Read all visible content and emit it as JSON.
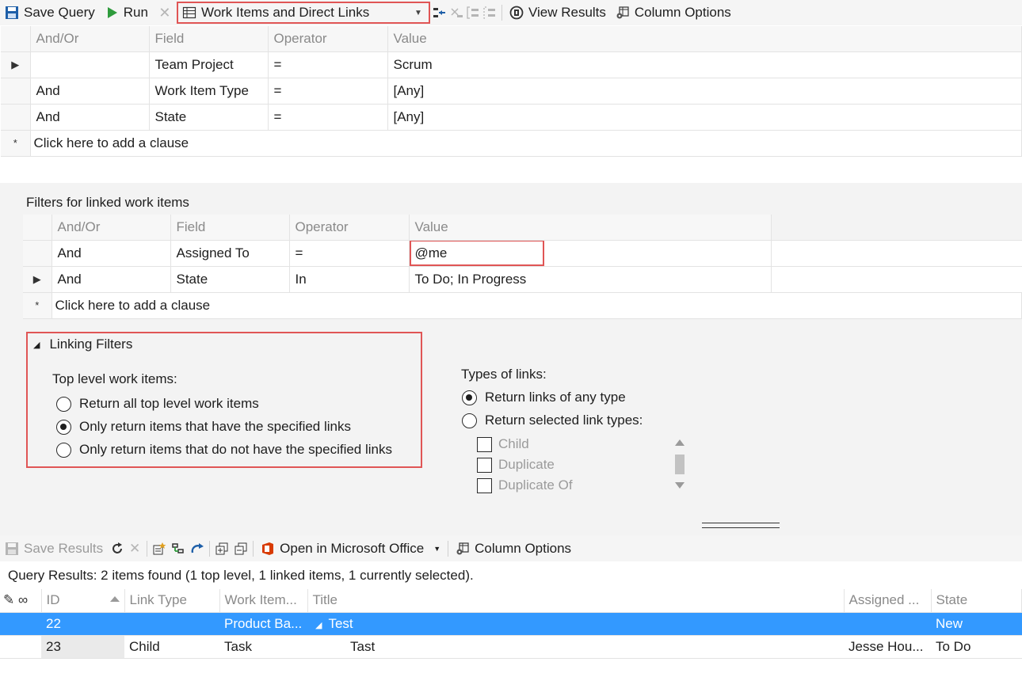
{
  "toolbar": {
    "save_query": "Save Query",
    "run": "Run",
    "query_type": "Work Items and Direct Links",
    "view_results": "View Results",
    "column_options": "Column Options"
  },
  "main_clauses": {
    "headers": [
      "And/Or",
      "Field",
      "Operator",
      "Value"
    ],
    "rows": [
      {
        "andor": "",
        "field": "Team Project",
        "operator": "=",
        "value": "Scrum"
      },
      {
        "andor": "And",
        "field": "Work Item Type",
        "operator": "=",
        "value": "[Any]"
      },
      {
        "andor": "And",
        "field": "State",
        "operator": "=",
        "value": "[Any]"
      }
    ],
    "add_clause": "Click here to add a clause"
  },
  "linked_filters": {
    "title": "Filters for linked work items",
    "headers": [
      "And/Or",
      "Field",
      "Operator",
      "Value"
    ],
    "rows": [
      {
        "andor": "And",
        "field": "Assigned To",
        "operator": "=",
        "value": "@me"
      },
      {
        "andor": "And",
        "field": "State",
        "operator": "In",
        "value": "To Do; In Progress"
      }
    ],
    "add_clause": "Click here to add a clause"
  },
  "linking_filters": {
    "title": "Linking Filters",
    "top_level_label": "Top level work items:",
    "options": [
      {
        "label": "Return all top level work items",
        "selected": false
      },
      {
        "label": "Only return items that have the specified links",
        "selected": true
      },
      {
        "label": "Only return items that do not have the specified links",
        "selected": false
      }
    ],
    "types_label": "Types of links:",
    "type_options": [
      {
        "label": "Return links of any type",
        "selected": true
      },
      {
        "label": "Return selected link types:",
        "selected": false
      }
    ],
    "link_types": [
      "Child",
      "Duplicate",
      "Duplicate Of"
    ]
  },
  "results_toolbar": {
    "save_results": "Save Results",
    "open_office": "Open in Microsoft Office",
    "column_options": "Column Options"
  },
  "results": {
    "summary": "Query Results: 2 items found (1 top level, 1 linked items, 1 currently selected).",
    "headers": {
      "id": "ID",
      "link_type": "Link Type",
      "work_item": "Work Item...",
      "title": "Title",
      "assigned": "Assigned ...",
      "state": "State"
    },
    "rows": [
      {
        "id": "22",
        "link_type": "",
        "work_item": "Product Ba...",
        "title": "Test",
        "assigned": "",
        "state": "New"
      },
      {
        "id": "23",
        "link_type": "Child",
        "work_item": "Task",
        "title": "Tast",
        "assigned": "Jesse Hou...",
        "state": "To Do"
      }
    ]
  },
  "colors": {
    "accent_red": "#e05555",
    "selection_blue": "#3399ff",
    "toolbar_bg": "#f5f5f5"
  }
}
